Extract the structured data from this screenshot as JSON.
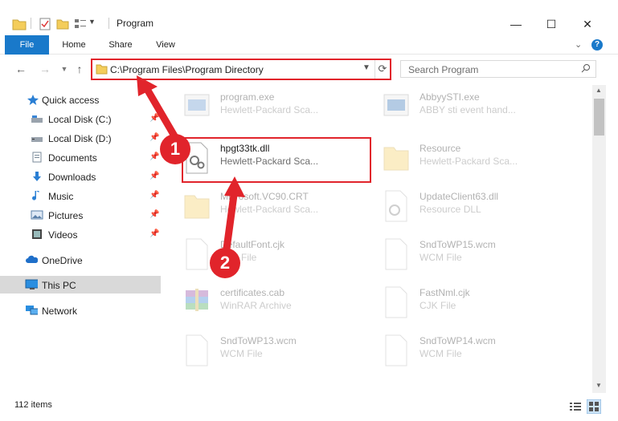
{
  "window": {
    "title": "Program"
  },
  "ribbon": {
    "tabs": [
      "File",
      "Home",
      "Share",
      "View"
    ]
  },
  "address": {
    "path": "C:\\Program Files\\Program Directory"
  },
  "search": {
    "placeholder": "Search Program"
  },
  "sidebar": {
    "items": [
      {
        "label": "Quick access",
        "icon": "star-icon"
      },
      {
        "label": "Local Disk (C:)",
        "icon": "drive-icon",
        "pinned": true
      },
      {
        "label": "Local Disk (D:)",
        "icon": "drive-icon",
        "pinned": true
      },
      {
        "label": "Documents",
        "icon": "documents-icon",
        "pinned": true
      },
      {
        "label": "Downloads",
        "icon": "downloads-icon",
        "pinned": true
      },
      {
        "label": "Music",
        "icon": "music-icon",
        "pinned": true
      },
      {
        "label": "Pictures",
        "icon": "pictures-icon",
        "pinned": true
      },
      {
        "label": "Videos",
        "icon": "videos-icon",
        "pinned": true
      },
      {
        "label": "OneDrive",
        "icon": "cloud-icon"
      },
      {
        "label": "This PC",
        "icon": "pc-icon",
        "selected": true
      },
      {
        "label": "Network",
        "icon": "network-icon"
      }
    ]
  },
  "files": [
    {
      "name": "program.exe",
      "sub": "Hewlett-Packard Sca...",
      "icon": "exe-icon"
    },
    {
      "name": "AbbyySTI.exe",
      "sub": "ABBY sti event hand...",
      "icon": "exe-icon"
    },
    {
      "name": "hpgt33tk.dll",
      "sub": "Hewlett-Packard Sca...",
      "icon": "dll-icon",
      "highlight": true
    },
    {
      "name": "Resource",
      "sub": "Hewlett-Packard Sca...",
      "icon": "folder-icon"
    },
    {
      "name": "Microsoft.VC90.CRT",
      "sub": "Hewlett-Packard Sca...",
      "icon": "folder-icon"
    },
    {
      "name": "UpdateClient63.dll",
      "sub": "Resource DLL",
      "icon": "dll-icon"
    },
    {
      "name": "DefaultFont.cjk",
      "sub": "CJK File",
      "icon": "file-icon"
    },
    {
      "name": "SndToWP15.wcm",
      "sub": "WCM File",
      "icon": "file-icon"
    },
    {
      "name": "certificates.cab",
      "sub": "WinRAR Archive",
      "icon": "archive-icon"
    },
    {
      "name": "FastNml.cjk",
      "sub": "CJK File",
      "icon": "file-icon"
    },
    {
      "name": "SndToWP13.wcm",
      "sub": "WCM File",
      "icon": "file-icon"
    },
    {
      "name": "SndToWP14.wcm",
      "sub": "WCM File",
      "icon": "file-icon"
    }
  ],
  "status": {
    "items": "112 items"
  },
  "annotations": {
    "badge1": "1",
    "badge2": "2"
  },
  "colors": {
    "accent": "#1979ca",
    "annotation": "#e1242b"
  }
}
